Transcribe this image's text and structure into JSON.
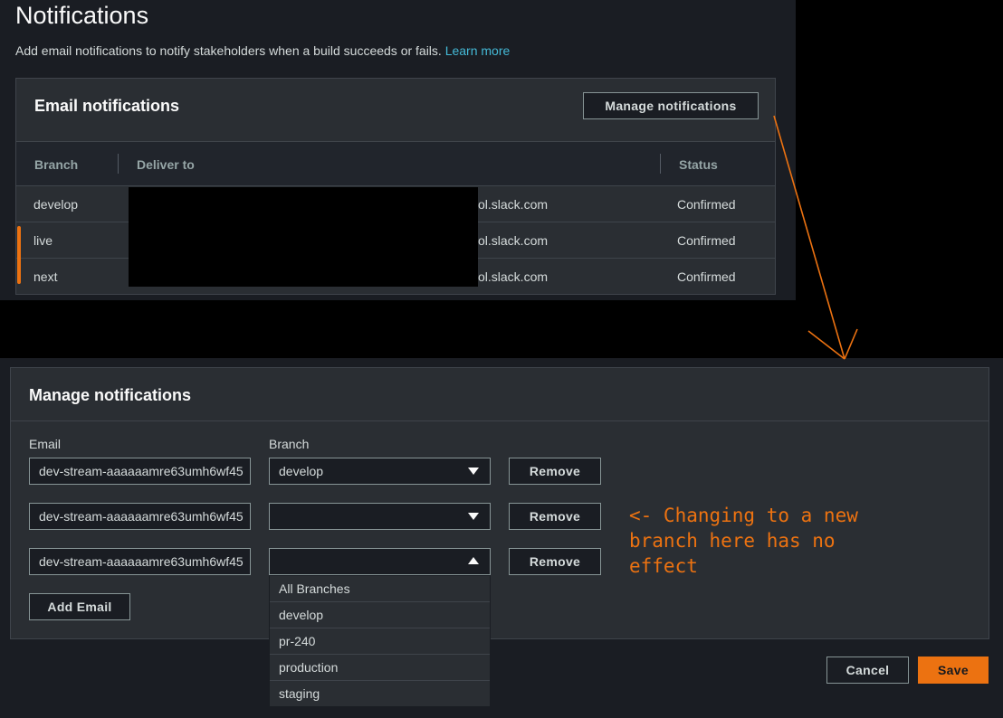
{
  "header": {
    "title": "Notifications",
    "description": "Add email notifications to notify stakeholders when a build succeeds or fails.",
    "learn_more": "Learn more"
  },
  "email_notifications": {
    "title": "Email notifications",
    "manage_button": "Manage notifications",
    "columns": [
      "Branch",
      "Deliver to",
      "Status"
    ],
    "rows": [
      {
        "branch": "develop",
        "deliver_to": "ol.slack.com",
        "status": "Confirmed"
      },
      {
        "branch": "live",
        "deliver_to": "ol.slack.com",
        "status": "Confirmed"
      },
      {
        "branch": "next",
        "deliver_to": "ol.slack.com",
        "status": "Confirmed"
      }
    ]
  },
  "manage": {
    "title": "Manage notifications",
    "email_label": "Email",
    "branch_label": "Branch",
    "entries": [
      {
        "email": "dev-stream-aaaaaamre63umh6wf45",
        "branch": "develop",
        "remove": "Remove"
      },
      {
        "email": "dev-stream-aaaaaamre63umh6wf45",
        "branch": "",
        "remove": "Remove"
      },
      {
        "email": "dev-stream-aaaaaamre63umh6wf45",
        "branch": "",
        "remove": "Remove"
      }
    ],
    "add_email": "Add Email",
    "dropdown_options": [
      "All Branches",
      "develop",
      "pr-240",
      "production",
      "staging"
    ]
  },
  "footer": {
    "cancel": "Cancel",
    "save": "Save"
  },
  "annotation": {
    "text": "<- Changing to a new\nbranch here has no\neffect",
    "color": "#ec7211"
  },
  "colors": {
    "accent": "#ec7211",
    "link": "#44b9d6",
    "panel": "#2a2e33",
    "background": "#1a1d23"
  }
}
